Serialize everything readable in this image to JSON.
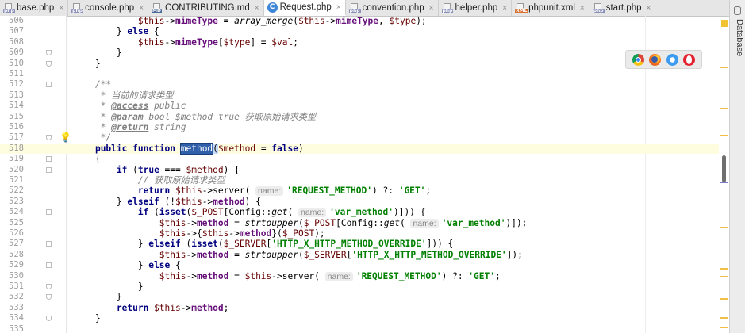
{
  "tabs": [
    {
      "label": "base.php",
      "type": "php",
      "active": false
    },
    {
      "label": "console.php",
      "type": "php",
      "active": false
    },
    {
      "label": "CONTRIBUTING.md",
      "type": "md",
      "active": false
    },
    {
      "label": "Request.php",
      "type": "class",
      "active": true
    },
    {
      "label": "convention.php",
      "type": "php",
      "active": false
    },
    {
      "label": "helper.php",
      "type": "php",
      "active": false
    },
    {
      "label": "phpunit.xml",
      "type": "xml",
      "active": false
    },
    {
      "label": "start.php",
      "type": "php",
      "active": false
    }
  ],
  "file_icon_labels": {
    "php": "php",
    "md": "MD",
    "xml": "XML",
    "class": "C"
  },
  "tab_close_glyph": "×",
  "right_panel": {
    "label": "Database"
  },
  "browsers": [
    {
      "name": "chrome-icon"
    },
    {
      "name": "firefox-icon"
    },
    {
      "name": "safari-icon"
    },
    {
      "name": "opera-icon"
    }
  ],
  "editor": {
    "current_line": 518,
    "lines": [
      {
        "n": "506",
        "tokens": [
          [
            "",
            "            "
          ],
          [
            "v",
            "$this"
          ],
          [
            "",
            "->"
          ],
          [
            "f",
            "mimeType"
          ],
          [
            "",
            " = "
          ],
          [
            "i",
            "array_merge"
          ],
          [
            "",
            "("
          ],
          [
            "v",
            "$this"
          ],
          [
            "",
            "->"
          ],
          [
            "f",
            "mimeType"
          ],
          [
            "",
            ", "
          ],
          [
            "v",
            "$type"
          ],
          [
            "",
            ");"
          ]
        ]
      },
      {
        "n": "507",
        "tokens": [
          [
            "",
            "        } "
          ],
          [
            "k",
            "else"
          ],
          [
            "",
            " {"
          ]
        ]
      },
      {
        "n": "508",
        "tokens": [
          [
            "",
            "            "
          ],
          [
            "v",
            "$this"
          ],
          [
            "",
            "->"
          ],
          [
            "f",
            "mimeType"
          ],
          [
            "",
            "["
          ],
          [
            "v",
            "$type"
          ],
          [
            "",
            "] = "
          ],
          [
            "v",
            "$val"
          ],
          [
            "",
            ";"
          ]
        ]
      },
      {
        "n": "509",
        "tokens": [
          [
            "",
            "        }"
          ]
        ]
      },
      {
        "n": "510",
        "tokens": [
          [
            "",
            "    }"
          ]
        ]
      },
      {
        "n": "511",
        "tokens": []
      },
      {
        "n": "512",
        "tokens": [
          [
            "c",
            "    /**"
          ]
        ]
      },
      {
        "n": "513",
        "tokens": [
          [
            "c",
            "     * 当前的请求类型"
          ]
        ]
      },
      {
        "n": "514",
        "tokens": [
          [
            "c",
            "     * "
          ],
          [
            "t",
            "@access"
          ],
          [
            "c",
            " public"
          ]
        ]
      },
      {
        "n": "515",
        "tokens": [
          [
            "c",
            "     * "
          ],
          [
            "t",
            "@param"
          ],
          [
            "c",
            " bool $method true "
          ],
          [
            "cn",
            "获取原始请求类型"
          ]
        ]
      },
      {
        "n": "516",
        "tokens": [
          [
            "c",
            "     * "
          ],
          [
            "t",
            "@return"
          ],
          [
            "c",
            " string"
          ]
        ]
      },
      {
        "n": "517",
        "tokens": [
          [
            "c",
            "     */"
          ]
        ]
      },
      {
        "n": "518",
        "tokens": [
          [
            "",
            "    "
          ],
          [
            "k",
            "public function"
          ],
          [
            "",
            " "
          ],
          [
            "hl",
            "method"
          ],
          [
            "brk",
            "("
          ],
          [
            "v",
            "$method"
          ],
          [
            "",
            " = "
          ],
          [
            "k",
            "false"
          ],
          [
            "",
            ")"
          ]
        ]
      },
      {
        "n": "519",
        "tokens": [
          [
            "",
            "    {"
          ]
        ]
      },
      {
        "n": "520",
        "tokens": [
          [
            "",
            "        "
          ],
          [
            "k",
            "if"
          ],
          [
            "",
            " ("
          ],
          [
            "k",
            "true"
          ],
          [
            "",
            " === "
          ],
          [
            "v",
            "$method"
          ],
          [
            "",
            ") {"
          ]
        ]
      },
      {
        "n": "521",
        "tokens": [
          [
            "c",
            "            // 获取原始请求类型"
          ]
        ]
      },
      {
        "n": "522",
        "tokens": [
          [
            "",
            "            "
          ],
          [
            "k",
            "return"
          ],
          [
            "",
            " "
          ],
          [
            "v",
            "$this"
          ],
          [
            "",
            "->server( "
          ],
          [
            "hint",
            "name:"
          ],
          [
            "s",
            "'REQUEST_METHOD'"
          ],
          [
            "",
            ") ?: "
          ],
          [
            "s",
            "'GET'"
          ],
          [
            "",
            ";"
          ]
        ]
      },
      {
        "n": "523",
        "tokens": [
          [
            "",
            "        } "
          ],
          [
            "k",
            "elseif"
          ],
          [
            "",
            " (!"
          ],
          [
            "v",
            "$this"
          ],
          [
            "",
            "->"
          ],
          [
            "f",
            "method"
          ],
          [
            "",
            ") {"
          ]
        ]
      },
      {
        "n": "524",
        "tokens": [
          [
            "",
            "            "
          ],
          [
            "k",
            "if"
          ],
          [
            "",
            " ("
          ],
          [
            "k",
            "isset"
          ],
          [
            "",
            "("
          ],
          [
            "v",
            "$_POST"
          ],
          [
            "",
            "[Config::"
          ],
          [
            "i",
            "get"
          ],
          [
            "",
            "( "
          ],
          [
            "hint",
            "name:"
          ],
          [
            "s",
            "'var_method'"
          ],
          [
            "",
            ")])) {"
          ]
        ]
      },
      {
        "n": "525",
        "tokens": [
          [
            "",
            "                "
          ],
          [
            "v",
            "$this"
          ],
          [
            "",
            "->"
          ],
          [
            "f",
            "method"
          ],
          [
            "",
            " = "
          ],
          [
            "i",
            "strtoupper"
          ],
          [
            "",
            "("
          ],
          [
            "v",
            "$_POST"
          ],
          [
            "",
            "[Config::"
          ],
          [
            "i",
            "get"
          ],
          [
            "",
            "( "
          ],
          [
            "hint",
            "name:"
          ],
          [
            "s",
            "'var_method'"
          ],
          [
            "",
            ")]);"
          ]
        ]
      },
      {
        "n": "526",
        "tokens": [
          [
            "",
            "                "
          ],
          [
            "v",
            "$this"
          ],
          [
            "",
            "->{"
          ],
          [
            "v",
            "$this"
          ],
          [
            "",
            "->"
          ],
          [
            "f",
            "method"
          ],
          [
            "",
            "}("
          ],
          [
            "v",
            "$_POST"
          ],
          [
            "",
            ");"
          ]
        ]
      },
      {
        "n": "527",
        "tokens": [
          [
            "",
            "            } "
          ],
          [
            "k",
            "elseif"
          ],
          [
            "",
            " ("
          ],
          [
            "k",
            "isset"
          ],
          [
            "",
            "("
          ],
          [
            "v",
            "$_SERVER"
          ],
          [
            "",
            "["
          ],
          [
            "s",
            "'HTTP_X_HTTP_METHOD_OVERRIDE'"
          ],
          [
            "",
            "])) {"
          ]
        ]
      },
      {
        "n": "528",
        "tokens": [
          [
            "",
            "                "
          ],
          [
            "v",
            "$this"
          ],
          [
            "",
            "->"
          ],
          [
            "f",
            "method"
          ],
          [
            "",
            " = "
          ],
          [
            "i",
            "strtoupper"
          ],
          [
            "",
            "("
          ],
          [
            "v",
            "$_SERVER"
          ],
          [
            "",
            "["
          ],
          [
            "s",
            "'HTTP_X_HTTP_METHOD_OVERRIDE'"
          ],
          [
            "",
            "]);"
          ]
        ]
      },
      {
        "n": "529",
        "tokens": [
          [
            "",
            "            } "
          ],
          [
            "k",
            "else"
          ],
          [
            "",
            " {"
          ]
        ]
      },
      {
        "n": "530",
        "tokens": [
          [
            "",
            "                "
          ],
          [
            "v",
            "$this"
          ],
          [
            "",
            "->"
          ],
          [
            "f",
            "method"
          ],
          [
            "",
            " = "
          ],
          [
            "v",
            "$this"
          ],
          [
            "",
            "->server( "
          ],
          [
            "hint",
            "name:"
          ],
          [
            "s",
            "'REQUEST_METHOD'"
          ],
          [
            "",
            ") ?: "
          ],
          [
            "s",
            "'GET'"
          ],
          [
            "",
            ";"
          ]
        ]
      },
      {
        "n": "531",
        "tokens": [
          [
            "",
            "            }"
          ]
        ]
      },
      {
        "n": "532",
        "tokens": [
          [
            "",
            "        }"
          ]
        ]
      },
      {
        "n": "533",
        "tokens": [
          [
            "",
            "        "
          ],
          [
            "k",
            "return"
          ],
          [
            "",
            " "
          ],
          [
            "v",
            "$this"
          ],
          [
            "",
            "->"
          ],
          [
            "f",
            "method"
          ],
          [
            "",
            ";"
          ]
        ]
      },
      {
        "n": "534",
        "tokens": [
          [
            "",
            "    }"
          ]
        ]
      },
      {
        "n": "535",
        "tokens": []
      }
    ]
  }
}
